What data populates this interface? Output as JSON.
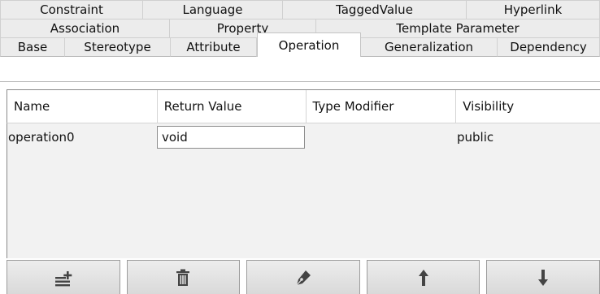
{
  "tabs": {
    "row1": [
      "Constraint",
      "Language",
      "TaggedValue",
      "Hyperlink"
    ],
    "row2": [
      "Association",
      "Property",
      "Template Parameter"
    ],
    "row3": [
      "Base",
      "Stereotype",
      "Attribute",
      "Operation",
      "Generalization",
      "Dependency"
    ],
    "active": "Operation"
  },
  "table": {
    "columns": [
      "Name",
      "Return Value",
      "Type Modifier",
      "Visibility"
    ],
    "rows": [
      {
        "name": "operation0",
        "return_value": "void",
        "type_modifier": "",
        "visibility": "public"
      }
    ]
  },
  "toolbar": {
    "buttons": [
      {
        "icon": "add-list-icon"
      },
      {
        "icon": "trash-icon"
      },
      {
        "icon": "pen-icon"
      },
      {
        "icon": "arrow-up-icon"
      },
      {
        "icon": "arrow-down-icon"
      }
    ]
  },
  "colors": {
    "tab_bg": "#ececec",
    "active_tab_bg": "#ffffff",
    "grid_bg": "#f2f2f2",
    "icon": "#444444"
  }
}
